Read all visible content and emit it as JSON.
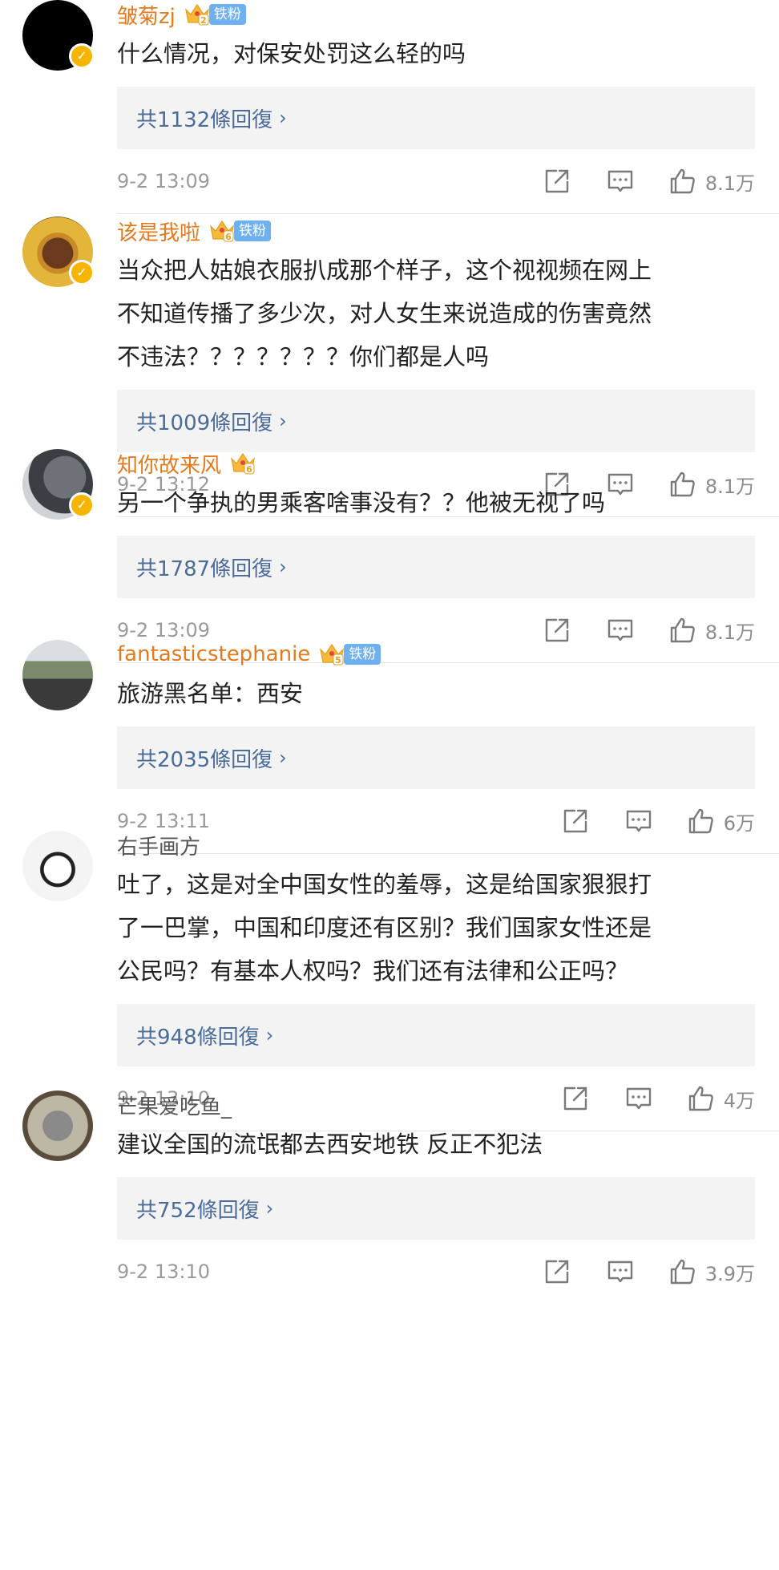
{
  "comments": [
    {
      "username": "皱菊zj",
      "verified": true,
      "level": "2",
      "fan_badge": "铁粉",
      "text_lines": [
        "什么情况，对保安处罚这么轻的吗"
      ],
      "replies_label": "共1132條回復",
      "time": "9-2 13:09",
      "likes": "8.1万"
    },
    {
      "username": "该是我啦",
      "verified": true,
      "level": "6",
      "fan_badge": "铁粉",
      "text_lines": [
        "当众把人姑娘衣服扒成那个样子，这个视视频在网上",
        "不知道传播了多少次，对人女生来说造成的伤害竟然",
        "不违法？？？？？？？你们都是人吗"
      ],
      "replies_label": "共1009條回復",
      "time": "9-2 13:12",
      "likes": "8.1万"
    },
    {
      "username": "知你故来风",
      "verified": true,
      "level": "6",
      "fan_badge": "",
      "text_lines": [
        "另一个争执的男乘客啥事没有？？他被无视了吗"
      ],
      "replies_label": "共1787條回復",
      "time": "9-2 13:09",
      "likes": "8.1万"
    },
    {
      "username": "fantasticstephanie",
      "verified": false,
      "level": "5",
      "fan_badge": "铁粉",
      "text_lines": [
        "旅游黑名单：西安"
      ],
      "replies_label": "共2035條回復",
      "time": "9-2 13:11",
      "likes": "6万"
    },
    {
      "username": "右手画方",
      "verified": false,
      "level": "",
      "fan_badge": "",
      "text_lines": [
        "吐了，这是对全中国女性的羞辱，这是给国家狠狠打",
        "了一巴掌，中国和印度还有区别？我们国家女性还是",
        "公民吗？有基本人权吗？我们还有法律和公正吗？"
      ],
      "replies_label": "共948條回復",
      "time": "9-2 13:10",
      "likes": "4万"
    },
    {
      "username": "芒果爱吃鱼_",
      "verified": false,
      "level": "",
      "fan_badge": "",
      "text_lines": [
        "建议全国的流氓都去西安地铁 反正不犯法"
      ],
      "replies_label": "共752條回復",
      "time": "9-2 13:10",
      "likes": "3.9万"
    }
  ],
  "colors": {
    "username_highlight": "#e47a1e",
    "reply_link": "#4a6c9b",
    "verified_badge": "#f7b500",
    "fan_badge": "#6fb0f0"
  },
  "icons": {
    "share": "share-icon",
    "comment": "comment-icon",
    "like": "like-icon",
    "chevron": "chevron-right-icon",
    "crown": "crown-level-icon"
  }
}
